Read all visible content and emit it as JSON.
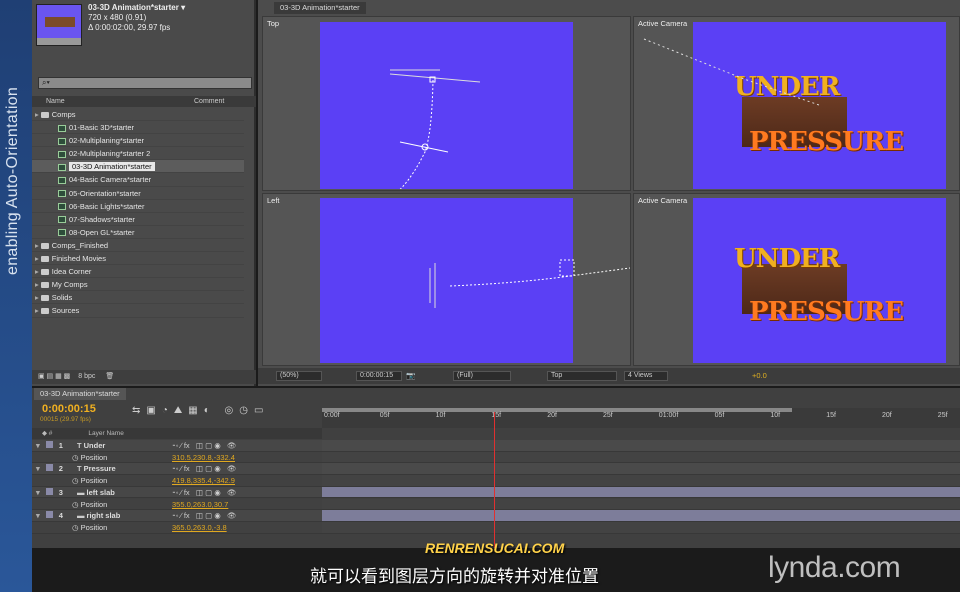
{
  "side_caption": "enabling Auto-Orientation",
  "project": {
    "comp_name": "03-3D Animation*starter ▾",
    "comp_size": "720 x 480 (0.91)",
    "comp_duration": "Δ 0:00:02:00, 29.97 fps",
    "search_placeholder": "⌕▾",
    "col_name": "Name",
    "col_comment": "Comment",
    "items": [
      {
        "label": "Comps",
        "type": "folder"
      },
      {
        "label": "01-Basic 3D*starter",
        "type": "comp"
      },
      {
        "label": "02-Multiplaning*starter",
        "type": "comp"
      },
      {
        "label": "02-Multiplaning*starter 2",
        "type": "comp"
      },
      {
        "label": "03-3D Animation*starter",
        "type": "comp",
        "selected": true
      },
      {
        "label": "04-Basic Camera*starter",
        "type": "comp"
      },
      {
        "label": "05-Orientation*starter",
        "type": "comp"
      },
      {
        "label": "06-Basic Lights*starter",
        "type": "comp"
      },
      {
        "label": "07-Shadows*starter",
        "type": "comp"
      },
      {
        "label": "08-Open GL*starter",
        "type": "comp"
      },
      {
        "label": "Comps_Finished",
        "type": "folder"
      },
      {
        "label": "Finished Movies",
        "type": "folder"
      },
      {
        "label": "Idea Corner",
        "type": "folder"
      },
      {
        "label": "My Comps",
        "type": "folder"
      },
      {
        "label": "Solids",
        "type": "folder"
      },
      {
        "label": "Sources",
        "type": "folder"
      }
    ],
    "bpc": "8 bpc"
  },
  "viewer": {
    "tab": "03-3D Animation*starter",
    "views": [
      "Top",
      "Active Camera",
      "Left",
      "Active Camera"
    ],
    "title_line1": "UNDER",
    "title_line2": "PRESSURE",
    "zoom": "(50%)",
    "timecode": "0:00:00:15",
    "resolution": "(Full)",
    "view": "Top",
    "layout": "4 Views",
    "exposure": "+0.0",
    "background_color": "#5b40f5"
  },
  "timeline": {
    "tab": "03-3D Animation*starter",
    "time": "0:00:00:15",
    "frames": "00015 (29.97 fps)",
    "col_layer_name": "Layer Name",
    "ruler": [
      "0:00f",
      "05f",
      "10f",
      "15f",
      "20f",
      "25f",
      "01:00f",
      "05f",
      "10f",
      "15f",
      "20f",
      "25f"
    ],
    "current_frame": 15,
    "rows": [
      {
        "kind": "layer",
        "num": "1",
        "name": "Under",
        "icon": "T"
      },
      {
        "kind": "prop",
        "name": "Position",
        "value": "310.5,230.8,-332.4"
      },
      {
        "kind": "layer",
        "num": "2",
        "name": "Pressure",
        "icon": "T"
      },
      {
        "kind": "prop",
        "name": "Position",
        "value": "419.8,335.4,-342.9"
      },
      {
        "kind": "layer",
        "num": "3",
        "name": "left slab",
        "icon": "▬"
      },
      {
        "kind": "prop",
        "name": "Position",
        "value": "355.0,263.0,30.7"
      },
      {
        "kind": "layer",
        "num": "4",
        "name": "right slab",
        "icon": "▬"
      },
      {
        "kind": "prop",
        "name": "Position",
        "value": "365.0,263.0,-3.8"
      }
    ]
  },
  "subtitle": "就可以看到图层方向的旋转并对准位置",
  "watermark": "RENRENSUCAI.COM",
  "brand": "lynda.com"
}
